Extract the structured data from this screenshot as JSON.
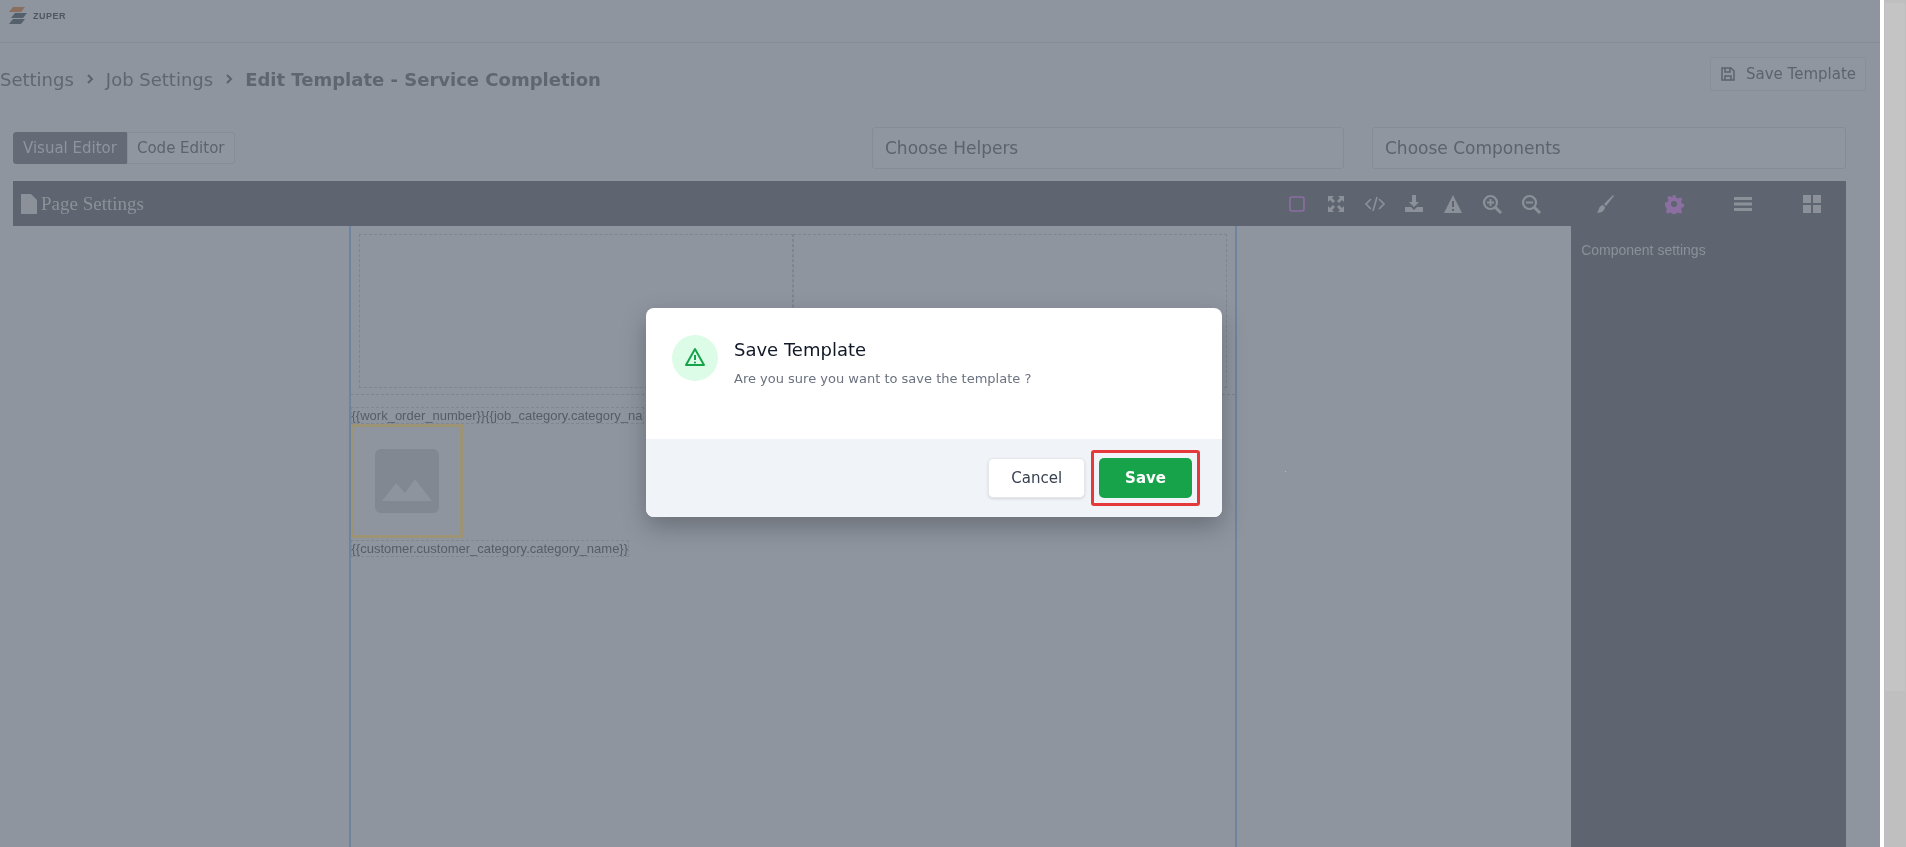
{
  "header": {
    "logo": "ZUPER"
  },
  "breadcrumb": [
    {
      "label": "Settings",
      "current": false
    },
    {
      "label": "Job Settings",
      "current": false
    },
    {
      "label": "Edit Template - Service Completion",
      "current": true
    }
  ],
  "save_template_button": "Save Template",
  "editor_tabs": [
    {
      "label": "Visual Editor",
      "selected": true
    },
    {
      "label": "Code Editor",
      "selected": false
    }
  ],
  "helpers_select": {
    "placeholder": "Choose Helpers"
  },
  "components_select": {
    "placeholder": "Choose Components"
  },
  "panel": {
    "title": "Page Settings",
    "toolbar": [
      {
        "kind": "square",
        "on": true
      },
      {
        "kind": "fullscreen",
        "on": false
      },
      {
        "kind": "code",
        "on": false
      },
      {
        "kind": "import",
        "on": false
      },
      {
        "kind": "warning",
        "on": false
      },
      {
        "kind": "zoom-in",
        "on": false
      },
      {
        "kind": "zoom-out",
        "on": false
      }
    ],
    "side_tabs": [
      {
        "kind": "brush",
        "selected": false
      },
      {
        "kind": "gear",
        "selected": true
      },
      {
        "kind": "bars",
        "selected": false
      },
      {
        "kind": "blocks",
        "selected": false
      }
    ],
    "side_heading": "Component settings"
  },
  "canvas": {
    "line_1": "{{work_order_number}}{{job_category.category_na",
    "line_2": "{{customer.customer_category.category_name}}"
  },
  "dialog": {
    "title": "Save Template",
    "message": "Are you sure you want to save the template ?",
    "buttons": [
      {
        "label": "Cancel",
        "kind": "secondary",
        "highlighted": false
      },
      {
        "label": "Save",
        "kind": "primary",
        "highlighted": true
      }
    ]
  }
}
